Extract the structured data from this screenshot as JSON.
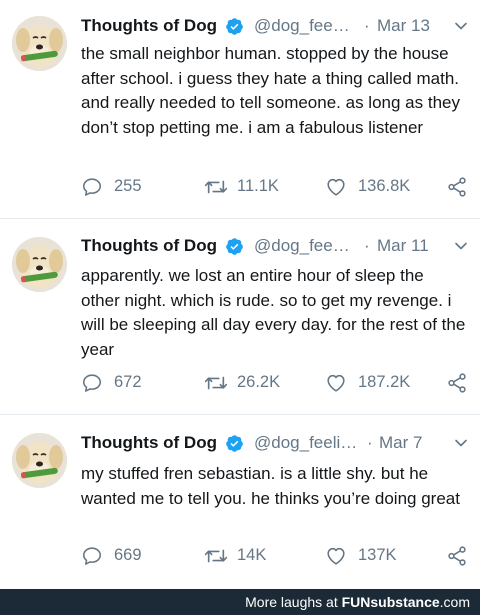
{
  "tweets": [
    {
      "name": "Thoughts of Dog",
      "handle": "@dog_fee…",
      "dot": "·",
      "date": "Mar 13",
      "text": "the small neighbor human. stopped by the house after school. i guess they hate a thing called math. and really needed to tell someone. as long as they don’t stop petting me. i am a fabulous listener",
      "replies": "255",
      "retweets": "11.1K",
      "likes": "136.8K"
    },
    {
      "name": "Thoughts of Dog",
      "handle": "@dog_fee…",
      "dot": "·",
      "date": "Mar 11",
      "text": "apparently. we lost an entire hour of sleep the other night. which is rude. so to get my revenge. i will be sleeping all day every day. for the rest of the year",
      "replies": "672",
      "retweets": "26.2K",
      "likes": "187.2K"
    },
    {
      "name": "Thoughts of Dog",
      "handle": "@dog_feeli…",
      "dot": "·",
      "date": "Mar 7",
      "text": "my stuffed fren sebastian. is a little shy. but he wanted me to tell you. he thinks you’re doing great",
      "replies": "669",
      "retweets": "14K",
      "likes": "137K"
    }
  ],
  "footer": {
    "prefix": "More laughs at",
    "brand": "FUNsubstance",
    "suffix": ".com"
  },
  "colors": {
    "text": "#14171a",
    "muted": "#657786",
    "verified": "#1da1f2",
    "footer_bg": "#1b2a36"
  },
  "icons": [
    "reply-icon",
    "retweet-icon",
    "like-icon",
    "share-icon",
    "verified-badge-icon",
    "chevron-down-icon"
  ]
}
